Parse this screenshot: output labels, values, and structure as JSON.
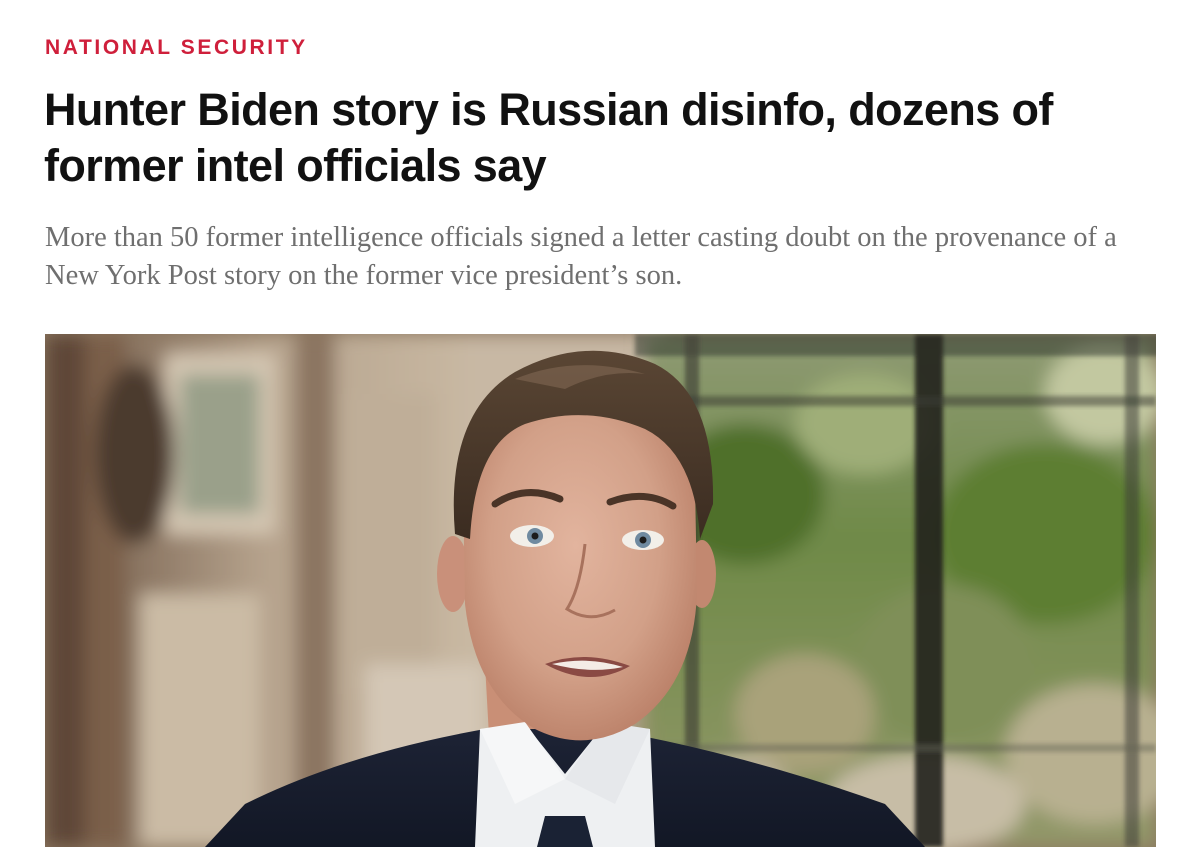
{
  "article": {
    "section_label": "NATIONAL SECURITY",
    "headline": "Hunter Biden story is Russian disinfo, dozens of former intel officials say",
    "dek": "More than 50 former intelligence officials signed a letter casting doubt on the provenance of a New York Post story on the former vice president’s son."
  },
  "colors": {
    "accent": "#cf1f3b",
    "headline": "#111111",
    "dek": "#6f6f6f"
  }
}
